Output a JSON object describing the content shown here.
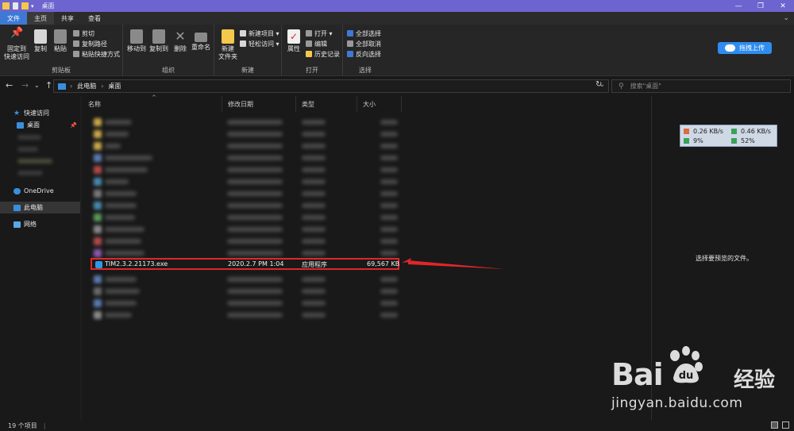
{
  "window": {
    "title": "桌面",
    "controls": [
      "—",
      "❐",
      "✕"
    ]
  },
  "tabs": [
    {
      "label": "文件"
    },
    {
      "label": "主页"
    },
    {
      "label": "共享"
    },
    {
      "label": "查看"
    }
  ],
  "ribbon": {
    "clipboard": {
      "group_label": "剪贴板",
      "pin_label_1": "固定到",
      "pin_label_2": "快速访问",
      "copy_label": "复制",
      "paste_label": "粘贴",
      "cut_label": "剪切",
      "copy_path_label": "复制路径",
      "paste_shortcut_label": "粘贴快捷方式"
    },
    "organize": {
      "group_label": "组织",
      "move_to_label": "移动到",
      "copy_to_label": "复制到",
      "delete_label": "删除",
      "rename_label": "重命名"
    },
    "new": {
      "group_label": "新建",
      "new_folder_label_1": "新建",
      "new_folder_label_2": "文件夹",
      "new_item_label": "新建项目 ▾",
      "easy_access_label": "轻松访问 ▾"
    },
    "open": {
      "group_label": "打开",
      "properties_label": "属性",
      "open_label": "打开 ▾",
      "edit_label": "编辑",
      "history_label": "历史记录"
    },
    "select": {
      "group_label": "选择",
      "select_all_label": "全部选择",
      "select_none_label": "全部取消",
      "invert_label": "反向选择"
    },
    "baidu_upload_label": "拖拽上传"
  },
  "address": {
    "crumbs": [
      "此电脑",
      "桌面"
    ],
    "search_placeholder": "搜索\"桌面\""
  },
  "navpane": {
    "quick_access": "快速访问",
    "desktop": "桌面",
    "onedrive": "OneDrive",
    "this_pc": "此电脑",
    "network": "网络"
  },
  "columns": {
    "name": "名称",
    "date": "修改日期",
    "type": "类型",
    "size": "大小"
  },
  "highlighted_file": {
    "name": "TIM2.3.2.21173.exe",
    "date": "2020.2.7 PM 1:04",
    "type": "应用程序",
    "size": "69,567 KB"
  },
  "preview": {
    "message": "选择要预览的文件。"
  },
  "net_monitor": {
    "upload": "0.26 KB/s",
    "download": "0.46 KB/s",
    "cpu": "9%",
    "memory": "52%"
  },
  "watermark": {
    "brand_left": "Bai",
    "brand_right": "经验",
    "url": "jingyan.baidu.com"
  },
  "status": {
    "item_count": "19 个项目",
    "divider": "|"
  },
  "colors": {
    "titlebar": "#6e64d0",
    "file_tab": "#3e79d6",
    "highlight_border": "#e0262a",
    "arrow": "#e0262a",
    "accent": "#2f8cf0"
  }
}
